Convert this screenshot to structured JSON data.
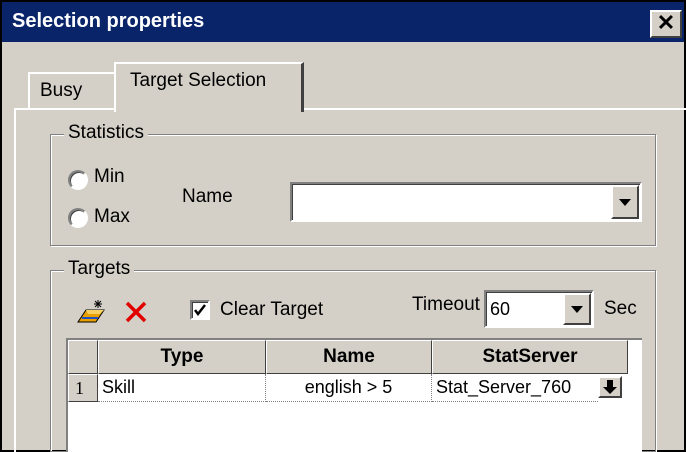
{
  "window": {
    "title": "Selection properties",
    "close_glyph": "✕"
  },
  "tabs": [
    {
      "label": "Busy",
      "selected": false
    },
    {
      "label": "Target Selection",
      "selected": true
    }
  ],
  "statistics": {
    "legend": "Statistics",
    "options": [
      {
        "label": "Min",
        "checked": false
      },
      {
        "label": "Max",
        "checked": false
      }
    ],
    "name_label": "Name",
    "name_value": ""
  },
  "targets": {
    "legend": "Targets",
    "toolbar": {
      "add_icon": "add-target-icon",
      "delete_icon": "delete-icon"
    },
    "clear_target": {
      "label": "Clear Target",
      "checked": true
    },
    "timeout": {
      "label": "Timeout",
      "value": "60",
      "unit": "Sec"
    },
    "grid": {
      "columns": [
        "Type",
        "Name",
        "StatServer"
      ],
      "rows": [
        {
          "index": "1",
          "type": "Skill",
          "name": "english > 5",
          "statserver": "Stat_Server_760"
        }
      ]
    }
  },
  "colors": {
    "titlebar": "#0a246a",
    "face": "#d4d0c8",
    "delete": "#e00000"
  }
}
